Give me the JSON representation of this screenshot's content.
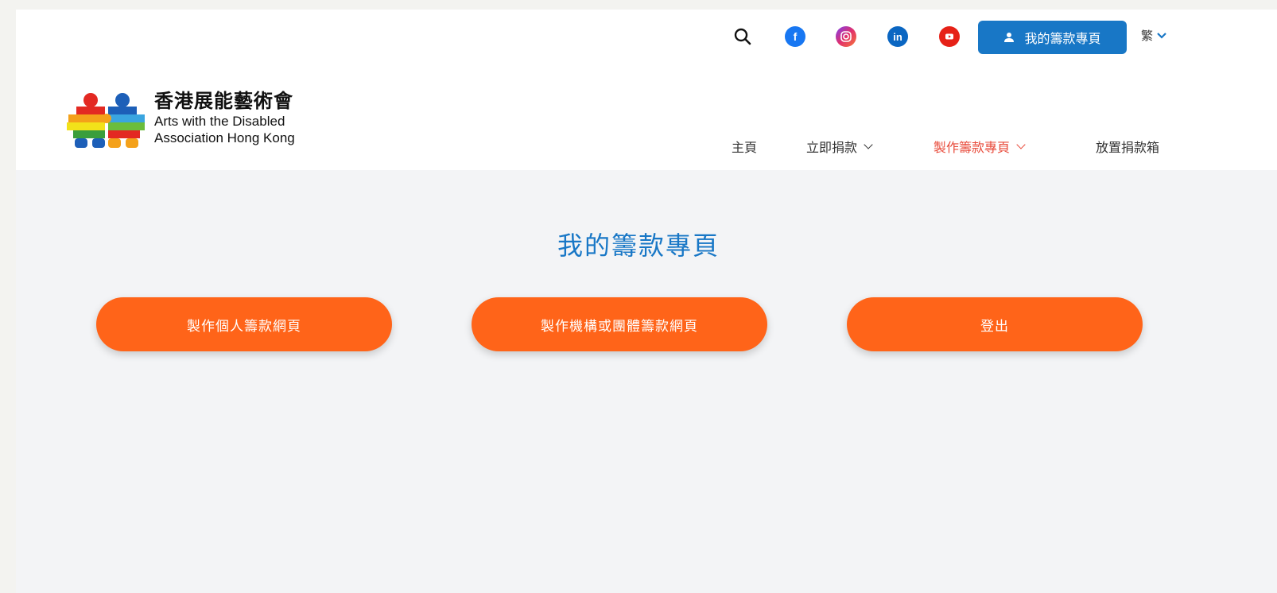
{
  "header": {
    "my_page_button": "我的籌款專頁",
    "language": "繁",
    "icons": [
      "search-icon",
      "facebook-icon",
      "instagram-icon",
      "linkedin-icon",
      "youtube-icon"
    ]
  },
  "logo": {
    "cn": "香港展能藝術會",
    "en_line1": "Arts with the Disabled",
    "en_line2": "Association Hong Kong"
  },
  "nav": {
    "items": [
      {
        "label": "主頁"
      },
      {
        "label": "立即捐款"
      },
      {
        "label": "製作籌款專頁"
      },
      {
        "label": "放置捐款箱"
      }
    ]
  },
  "main": {
    "title": "我的籌款專頁",
    "buttons": [
      {
        "label": "製作個人籌款網頁"
      },
      {
        "label": "製作機構或團體籌款網頁"
      },
      {
        "label": "登出"
      }
    ]
  },
  "colors": {
    "accent_blue": "#1877c6",
    "orange": "#ff6419",
    "nav_active": "#e84a3a"
  }
}
